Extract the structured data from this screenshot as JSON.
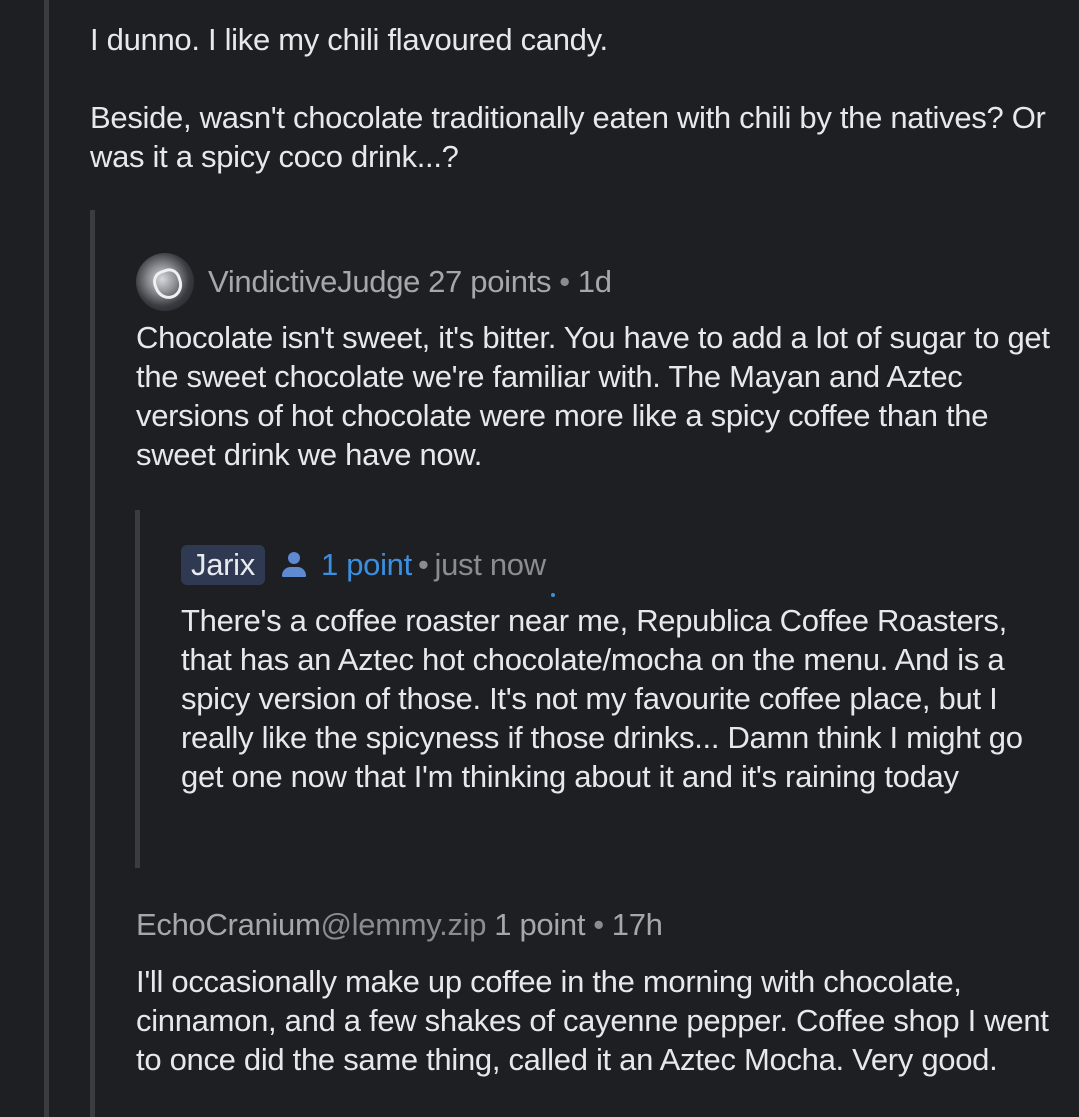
{
  "comments": {
    "top": {
      "paragraph1": "I dunno. I like my chili flavoured candy.",
      "paragraph2": "Beside, wasn't chocolate traditionally eaten with chili by the natives? Or was it a spicy coco drink...?"
    },
    "vindictive": {
      "username": "VindictiveJudge",
      "points": "27 points",
      "separator": "•",
      "age": "1d",
      "body": "Chocolate isn't sweet, it's bitter. You have to add a lot of sugar to get the sweet chocolate we're familiar with. The Mayan and Aztec versions of hot chocolate were more like a spicy coffee than the sweet drink we have now."
    },
    "jarix": {
      "username": "Jarix",
      "points": "1 point",
      "separator": "•",
      "age": "just now",
      "body": "There's a coffee roaster near me, Republica Coffee Roasters, that has an Aztec hot chocolate/mocha on the menu. And is a spicy version of those. It's not my favourite coffee place, but I really like the spicyness if those drinks... Damn think I might go get one now that I'm thinking about it and it's raining today"
    },
    "echo": {
      "username": "EchoCranium",
      "instance": "@lemmy.zip",
      "points": "1 point",
      "separator": "•",
      "age": "17h",
      "body": "I'll occasionally make up coffee in the morning with chocolate, cinnamon, and a few shakes of cayenne pepper. Coffee shop I went to once did the same thing, called it an Aztec Mocha. Very good."
    }
  },
  "icons": {
    "own_user": "person-icon",
    "avatar": "avatar-image"
  },
  "colors": {
    "background": "#1e1f23",
    "thread_line": "#3b3c41",
    "own_badge": "#2f3a52",
    "own_points": "#3b8fe0"
  }
}
